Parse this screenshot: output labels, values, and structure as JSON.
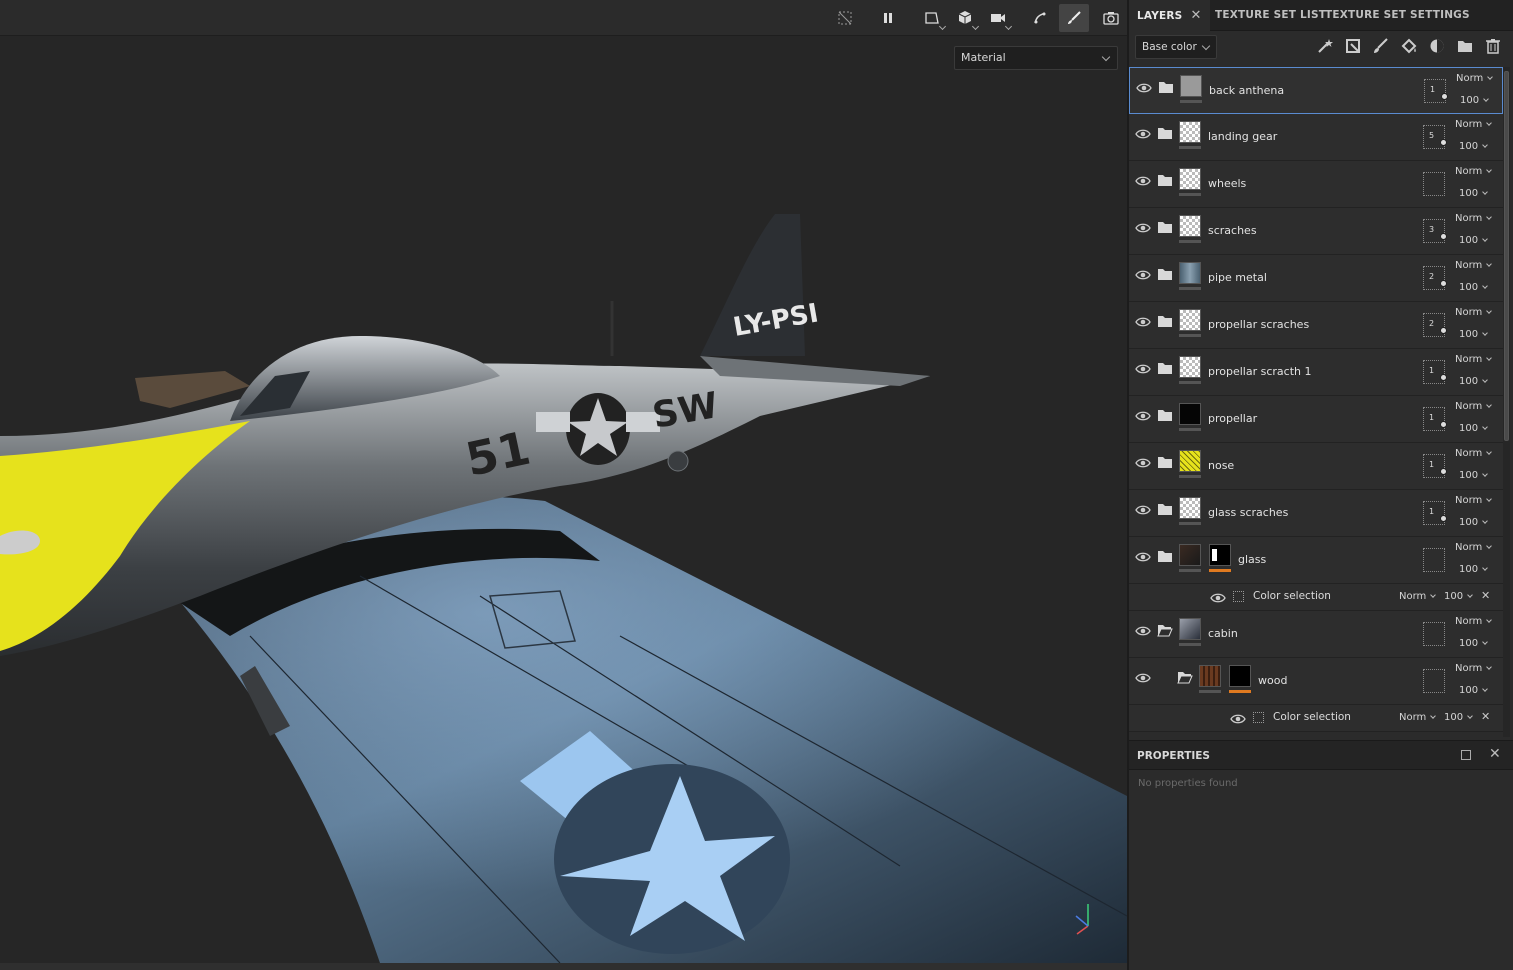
{
  "viewport": {
    "material_mode": "Material",
    "toolbar_icons": [
      "hide-overlay-icon",
      "pause-icon",
      "projection-2d-icon",
      "view-3d-icon",
      "camera-icon",
      "symmetry-icon",
      "paint-brush-icon",
      "screenshot-icon"
    ],
    "plane_markings": {
      "tail_code": "LY-PSI",
      "fuselage_number": "51",
      "fuselage_code": "SW"
    }
  },
  "panel": {
    "tabs": [
      {
        "label": "LAYERS",
        "active": true
      },
      {
        "label": "TEXTURE SET LIST",
        "active": false
      },
      {
        "label": "TEXTURE SET SETTINGS",
        "active": false
      }
    ],
    "channel": "Base color",
    "channel_tools": [
      "magic-wand-icon",
      "effect-icon",
      "paint-icon",
      "fill-icon",
      "smart-material-icon",
      "folder-icon",
      "trash-icon"
    ],
    "layers": [
      {
        "name": "back anthena",
        "blend": "Norm",
        "opacity": "100",
        "mask_count": "1",
        "thumb": "gray",
        "selected": true
      },
      {
        "name": "landing gear",
        "blend": "Norm",
        "opacity": "100",
        "mask_count": "5",
        "thumb": "checker"
      },
      {
        "name": "wheels",
        "blend": "Norm",
        "opacity": "100",
        "mask_count": "",
        "thumb": "checker"
      },
      {
        "name": "scraches",
        "blend": "Norm",
        "opacity": "100",
        "mask_count": "3",
        "thumb": "checker"
      },
      {
        "name": "pipe metal",
        "blend": "Norm",
        "opacity": "100",
        "mask_count": "2",
        "thumb": "metal"
      },
      {
        "name": "propellar scraches",
        "blend": "Norm",
        "opacity": "100",
        "mask_count": "2",
        "thumb": "checker"
      },
      {
        "name": "propellar scracth 1",
        "blend": "Norm",
        "opacity": "100",
        "mask_count": "1",
        "thumb": "checker"
      },
      {
        "name": "propellar",
        "blend": "Norm",
        "opacity": "100",
        "mask_count": "1",
        "thumb": "black"
      },
      {
        "name": "nose",
        "blend": "Norm",
        "opacity": "100",
        "mask_count": "1",
        "thumb": "yellow"
      },
      {
        "name": "glass scraches",
        "blend": "Norm",
        "opacity": "100",
        "mask_count": "1",
        "thumb": "checker"
      },
      {
        "name": "glass",
        "blend": "Norm",
        "opacity": "100",
        "mask_count": "",
        "thumb": "dark",
        "has_mask": true,
        "effect": {
          "name": "Color selection",
          "blend": "Norm",
          "opacity": "100"
        }
      },
      {
        "name": "cabin",
        "blend": "Norm",
        "opacity": "100",
        "mask_count": "",
        "thumb": "cabin"
      },
      {
        "name": "wood",
        "blend": "Norm",
        "opacity": "100",
        "mask_count": "",
        "thumb": "wood",
        "has_mask": true,
        "indented": true,
        "effect": {
          "name": "Color selection",
          "blend": "Norm",
          "opacity": "100"
        }
      }
    ],
    "properties": {
      "title": "PROPERTIES",
      "empty_text": "No properties found"
    }
  },
  "colors": {
    "selection": "#5a8bd0",
    "mask_accent": "#e07a20",
    "nose_yellow": "#e6e21c",
    "roundel_blue": "#7ab0e8"
  }
}
